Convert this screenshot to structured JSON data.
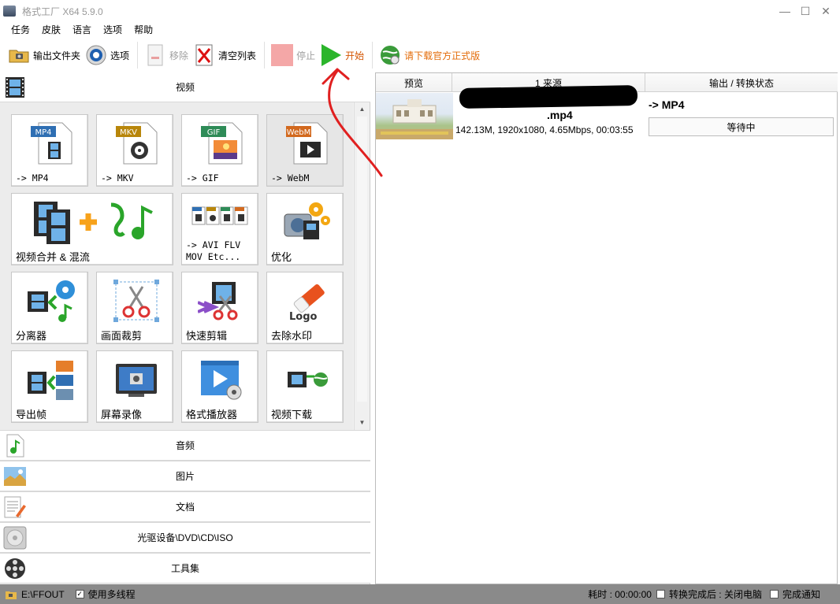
{
  "window": {
    "title": "格式工厂 X64 5.9.0"
  },
  "menu": [
    "任务",
    "皮肤",
    "语言",
    "选项",
    "帮助"
  ],
  "toolbar": {
    "output_folder": "输出文件夹",
    "options": "选项",
    "remove": "移除",
    "clear_list": "清空列表",
    "stop": "停止",
    "start": "开始",
    "download_official": "请下载官方正式版"
  },
  "categories": {
    "video": "视频",
    "audio": "音频",
    "image": "图片",
    "document": "文档",
    "optical": "光驱设备\\DVD\\CD\\ISO",
    "tools": "工具集"
  },
  "tiles": [
    {
      "label": "-> MP4",
      "badge": "MP4",
      "badge_color": "#2f6fb3",
      "icon": "mp4-file-icon"
    },
    {
      "label": "-> MKV",
      "badge": "MKV",
      "badge_color": "#b8860b",
      "icon": "mkv-file-icon"
    },
    {
      "label": "-> GIF",
      "badge": "GIF",
      "badge_color": "#2e8b57",
      "icon": "gif-file-icon"
    },
    {
      "label": "-> WebM",
      "badge": "WebM",
      "badge_color": "#d2691e",
      "icon": "webm-file-icon"
    },
    {
      "label": "视频合并 & 混流",
      "icon": "merge-mux-icon"
    },
    {
      "label": "-> AVI FLV\nMOV Etc...",
      "icon": "other-formats-icon"
    },
    {
      "label": "优化",
      "icon": "optimize-icon"
    },
    {
      "label": "分离器",
      "icon": "splitter-icon"
    },
    {
      "label": "画面裁剪",
      "icon": "crop-icon"
    },
    {
      "label": "快速剪辑",
      "icon": "quick-clip-icon"
    },
    {
      "label": "去除水印",
      "icon": "remove-watermark-icon",
      "logo_text": "Logo"
    },
    {
      "label": "导出帧",
      "icon": "export-frames-icon"
    },
    {
      "label": "屏幕录像",
      "icon": "screen-record-icon"
    },
    {
      "label": "格式播放器",
      "icon": "player-icon"
    },
    {
      "label": "视频下载",
      "icon": "video-download-icon"
    }
  ],
  "table": {
    "headers": [
      "预览",
      "1 来源",
      "输出 / 转换状态"
    ],
    "rows": [
      {
        "filename": ".mp4",
        "info": "142.13M, 1920x1080, 4.65Mbps, 00:03:55",
        "output_format": "-> MP4",
        "status": "等待中"
      }
    ]
  },
  "statusbar": {
    "output_path": "E:\\FFOUT",
    "multithread": "使用多线程",
    "multithread_checked": true,
    "elapsed": "耗时 : 00:00:00",
    "after_convert": "转换完成后 : 关闭电脑",
    "notify": "完成通知"
  },
  "colors": {
    "start_green": "#2bb52b",
    "download_orange": "#e36c0a",
    "annotation_red": "#e02020",
    "statusbar_gray": "#8a8a8a"
  }
}
